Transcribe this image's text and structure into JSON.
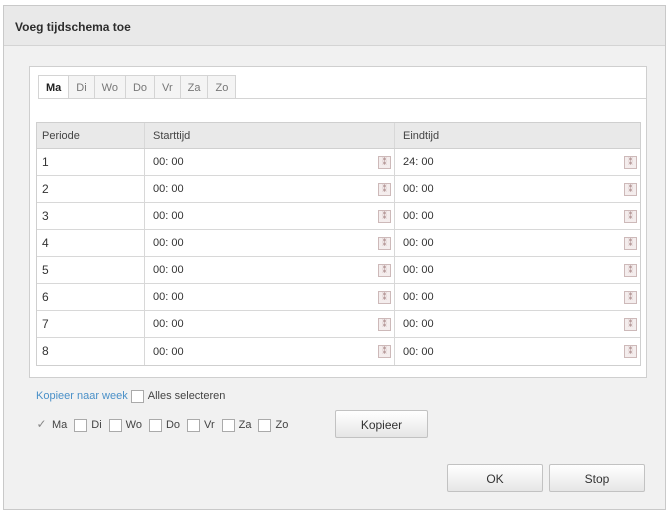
{
  "dialog": {
    "title": "Voeg tijdschema toe"
  },
  "tabs": [
    {
      "label": "Ma",
      "active": true
    },
    {
      "label": "Di"
    },
    {
      "label": "Wo"
    },
    {
      "label": "Do"
    },
    {
      "label": "Vr"
    },
    {
      "label": "Za"
    },
    {
      "label": "Zo"
    }
  ],
  "table": {
    "headers": [
      "Periode",
      "Starttijd",
      "Eindtijd"
    ],
    "rows": [
      {
        "period": "1",
        "start": "00: 00",
        "end": "24: 00"
      },
      {
        "period": "2",
        "start": "00: 00",
        "end": "00: 00"
      },
      {
        "period": "3",
        "start": "00: 00",
        "end": "00: 00"
      },
      {
        "period": "4",
        "start": "00: 00",
        "end": "00: 00"
      },
      {
        "period": "5",
        "start": "00: 00",
        "end": "00: 00"
      },
      {
        "period": "6",
        "start": "00: 00",
        "end": "00: 00"
      },
      {
        "period": "7",
        "start": "00: 00",
        "end": "00: 00"
      },
      {
        "period": "8",
        "start": "00: 00",
        "end": "00: 00"
      }
    ]
  },
  "copy": {
    "link_label": "Kopieer naar week",
    "select_all_label": "Alles selecteren",
    "days": [
      {
        "label": "Ma",
        "checked": true
      },
      {
        "label": "Di",
        "checked": false
      },
      {
        "label": "Wo",
        "checked": false
      },
      {
        "label": "Do",
        "checked": false
      },
      {
        "label": "Vr",
        "checked": false
      },
      {
        "label": "Za",
        "checked": false
      },
      {
        "label": "Zo",
        "checked": false
      }
    ],
    "copy_button_label": "Kopieer"
  },
  "footer": {
    "ok_label": "OK",
    "stop_label": "Stop"
  },
  "icons": {
    "time_picker": "clock-picker-icon",
    "checkmark": "✓"
  }
}
